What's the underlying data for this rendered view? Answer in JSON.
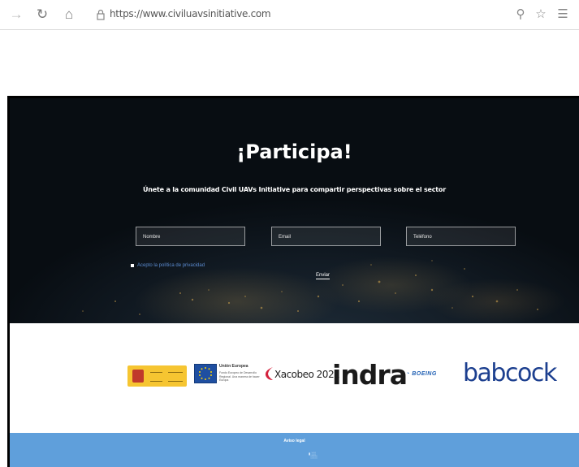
{
  "browser": {
    "url": "https://www.civiluavsinitiative.com",
    "icons": [
      "back-arrow-icon",
      "refresh-icon",
      "home-icon",
      "lock-icon",
      "zoom-icon",
      "favorite-star-icon",
      "favorites-list-icon"
    ]
  },
  "hero": {
    "title": "¡Participa!",
    "subtitle": "Únete a la comunidad Civil UAVs Initiative para compartir perspectivas sobre el sector",
    "fields": [
      {
        "placeholder": "Nombre"
      },
      {
        "placeholder": "Email"
      },
      {
        "placeholder": "Teléfono"
      }
    ],
    "privacy_text": "Acepto la política de privacidad",
    "send_label": "Enviar"
  },
  "sponsors": {
    "eu_title": "Unión Europea",
    "eu_sub": "Fondo Europeo de Desarrollo Regional. Una manera de hacer Europa",
    "xacobeo": "Xacobeo 2021",
    "indra": "indra",
    "boeing": "BOEING",
    "babcock": "babcock"
  },
  "footer": {
    "legal_link": "Aviso legal"
  },
  "colors": {
    "footer": "#5f9fdb",
    "hero_bg": "#0a0f14",
    "indra": "#1a1a1a",
    "babcock": "#1c3f8f",
    "boeing": "#1f5fb3"
  }
}
